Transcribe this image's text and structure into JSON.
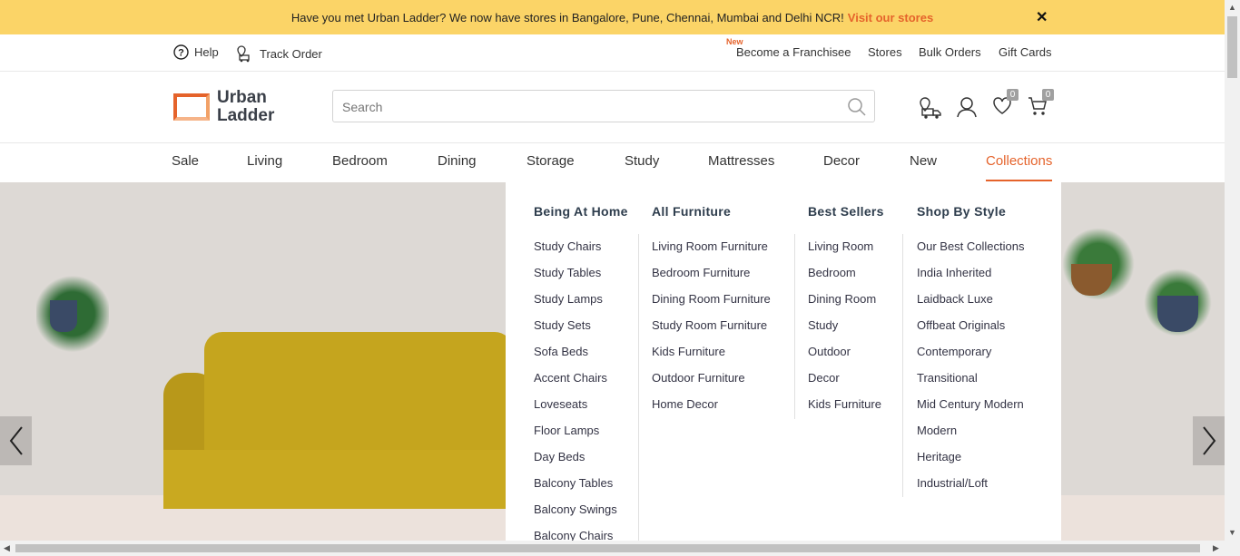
{
  "banner": {
    "message": "Have you met Urban Ladder? We now have stores in Bangalore, Pune, Chennai, Mumbai and Delhi NCR!",
    "link": "Visit our stores",
    "close": "✕"
  },
  "topbar": {
    "help": "Help",
    "track_order": "Track Order",
    "new_tag": "New",
    "links": [
      "Become a Franchisee",
      "Stores",
      "Bulk Orders",
      "Gift Cards"
    ]
  },
  "header": {
    "logo_line1": "Urban",
    "logo_line2": "Ladder",
    "search_placeholder": "Search",
    "wishlist_count": "0",
    "cart_count": "0"
  },
  "nav": [
    "Sale",
    "Living",
    "Bedroom",
    "Dining",
    "Storage",
    "Study",
    "Mattresses",
    "Decor",
    "New",
    "Collections"
  ],
  "mega_menu": {
    "columns": [
      {
        "heading": "Being At Home",
        "items": [
          "Study Chairs",
          "Study Tables",
          "Study Lamps",
          "Study Sets",
          "Sofa Beds",
          "Accent Chairs",
          "Loveseats",
          "Floor Lamps",
          "Day Beds",
          "Balcony Tables",
          "Balcony Swings",
          "Balcony Chairs"
        ]
      },
      {
        "heading": "All Furniture",
        "items": [
          "Living Room Furniture",
          "Bedroom Furniture",
          "Dining Room Furniture",
          "Study Room Furniture",
          "Kids Furniture",
          "Outdoor Furniture",
          "Home Decor"
        ]
      },
      {
        "heading": "Best Sellers",
        "items": [
          "Living Room",
          "Bedroom",
          "Dining Room",
          "Study",
          "Outdoor",
          "Decor",
          "Kids Furniture"
        ]
      },
      {
        "heading": "Shop By Style",
        "items": [
          "Our Best Collections",
          "India Inherited",
          "Laidback Luxe",
          "Offbeat Originals",
          "Contemporary",
          "Transitional",
          "Mid Century Modern",
          "Modern",
          "Heritage",
          "Industrial/Loft"
        ]
      }
    ]
  },
  "colors": {
    "banner_bg": "#fbd467",
    "accent": "#e5632b"
  }
}
